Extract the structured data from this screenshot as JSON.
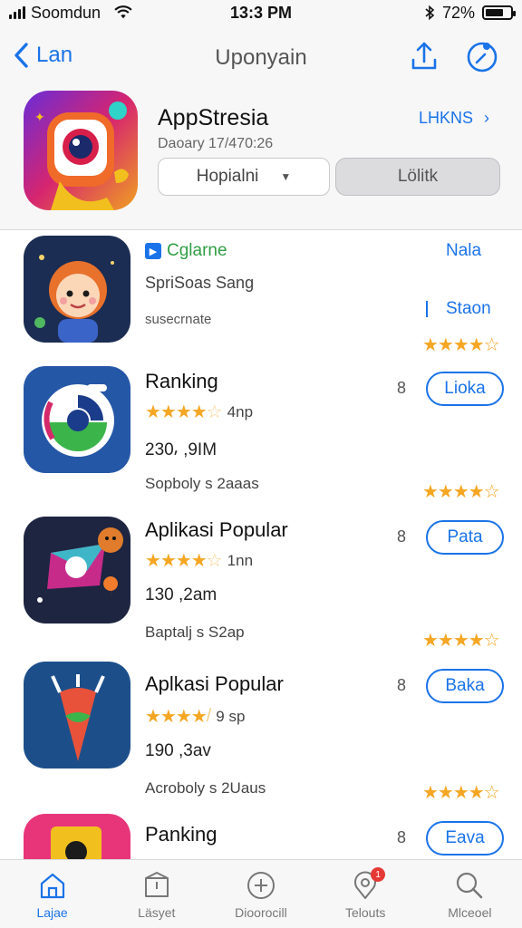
{
  "status_bar": {
    "carrier": "Soomdun",
    "time": "13:3 PM",
    "battery": "72%",
    "battery_level": 0.72
  },
  "nav": {
    "back_label": "Lan",
    "title": "Uponyain"
  },
  "featured": {
    "name": "AppStresia",
    "subtitle": "Daoary 17/470:26",
    "link_label": "LHKNS",
    "link_arrow": "›",
    "select_value": "Hopialni",
    "action_label": "Lölitk"
  },
  "first_row": {
    "tag": "Cglarne",
    "subtitle": "SpriSoas Sang",
    "caption": "susecrnate",
    "side_link_1": "Nala",
    "side_link_2": "Staon",
    "stars": "★★★★☆"
  },
  "apps": [
    {
      "name": "Ranking",
      "stars": "★★★★",
      "half": "☆",
      "rating": "4np",
      "size": "230⸴ ,9IM",
      "developer": "Sopboly s 2aaas",
      "num": "8",
      "button": "Lioka",
      "right_stars": "★★★★☆"
    },
    {
      "name": "Aplikasi Popular",
      "stars": "★★★★",
      "half": "☆",
      "rating": "1nn",
      "size": "130 ,2am",
      "developer": "Baptalj s S2ap",
      "num": "8",
      "button": "Pata",
      "right_stars": "★★★★☆"
    },
    {
      "name": "Aplkasi Popular",
      "stars": "★★★★",
      "half": "/",
      "rating": "9 sp",
      "size": "190 ,3av",
      "developer": "Acrobolу s 2Uaus",
      "num": "8",
      "button": "Baka",
      "right_stars": "★★★★☆"
    },
    {
      "name": "Panking",
      "stars": "",
      "half": "",
      "rating": "",
      "size": "",
      "developer": "",
      "num": "8",
      "button": "Eava",
      "right_stars": ""
    }
  ],
  "tabs": [
    {
      "label": "Lajae",
      "icon": "home-icon",
      "active": true
    },
    {
      "label": "Läsyet",
      "icon": "box-icon",
      "active": false
    },
    {
      "label": "Dioorocill",
      "icon": "plus-circle-icon",
      "active": false
    },
    {
      "label": "Telouts",
      "icon": "location-pin-icon",
      "active": false,
      "badge": "1"
    },
    {
      "label": "Mlceoel",
      "icon": "search-icon",
      "active": false
    }
  ],
  "colors": {
    "accent": "#1a73e8",
    "star": "#f5a623",
    "tag_green": "#2f9e44",
    "badge": "#e53935"
  }
}
